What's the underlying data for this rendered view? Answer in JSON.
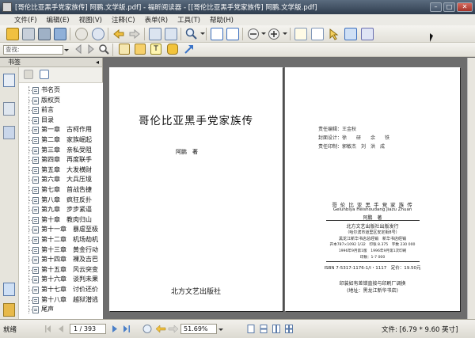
{
  "window": {
    "title": "[哥伦比亚黑手党家族传] 阿鹏.文学版.pdf] - 福昕阅读器 - [[哥伦比亚黑手党家族传] 阿鹏.文学版.pdf]",
    "buttons": [
      "minimize",
      "maximize",
      "close"
    ]
  },
  "menubar": {
    "items": [
      "文件(F)",
      "编辑(E)",
      "视图(V)",
      "注释(C)",
      "表单(R)",
      "工具(T)",
      "帮助(H)"
    ]
  },
  "toolbar2": {
    "search_placeholder": "查找:"
  },
  "sidebar": {
    "header": "书签",
    "bookmarks": [
      "书名页",
      "版权页",
      "前言",
      "目录",
      "第一章　古柯作用",
      "第二章　家族崛起",
      "第三章　亲私受阻",
      "第四章　再度联手",
      "第五章　大发横财",
      "第六章　大兵压境",
      "第七章　首战告捷",
      "第八章　疯狂反扑",
      "第九章　步步紧逼",
      "第十章　教肉归山",
      "第十一章　暴虐至极",
      "第十二章　机场劫机",
      "第十三章　黄金行动",
      "第十四章　裸及吉巴",
      "第十五章　风云突变",
      "第十六章　谈判未果",
      "第十七章　讨价还价",
      "第十八章　越狱潜逃",
      "尾声"
    ]
  },
  "document": {
    "left_page": {
      "title": "哥伦比亚黑手党家族传",
      "author": "阿鹏　著",
      "publisher": "北方文艺出版社"
    },
    "right_page": {
      "credits": [
        "责任编辑：王金秋",
        "封面设计：徐　　研　　余　　铁",
        "责任印制：郭敏杰　刘　洪　成"
      ],
      "cip_title": "哥 伦 比 亚 黑 手 党 家 族 传",
      "pinyin": "Gelunbiya Heishoudang Jiazu Zhuan",
      "cip_author": "阿鹏　著",
      "cip_lines": [
        "北方文艺出版社出版发行",
        "（哈尔滨市道里区安定街8号）",
        "黑龙江新华书店总经销　新华书店经销",
        "开本787×1092 1/32　印张 8.375　字数 230 000",
        "1996年9月第1版　1996年9月第1次印刷",
        "印数：1-7 000",
        "ISBN 7-5317-1176-1/I・1117　定价：19.50元"
      ],
      "footer_lines": [
        "印装如有差错直接与印刷厂调换",
        "(地址：黑龙江新华书店)"
      ]
    }
  },
  "statusbar": {
    "status": "就绪",
    "page": "1 / 393",
    "zoom": "51.69%",
    "fileinfo": "文件: [6.79 * 9.60 英寸]"
  }
}
